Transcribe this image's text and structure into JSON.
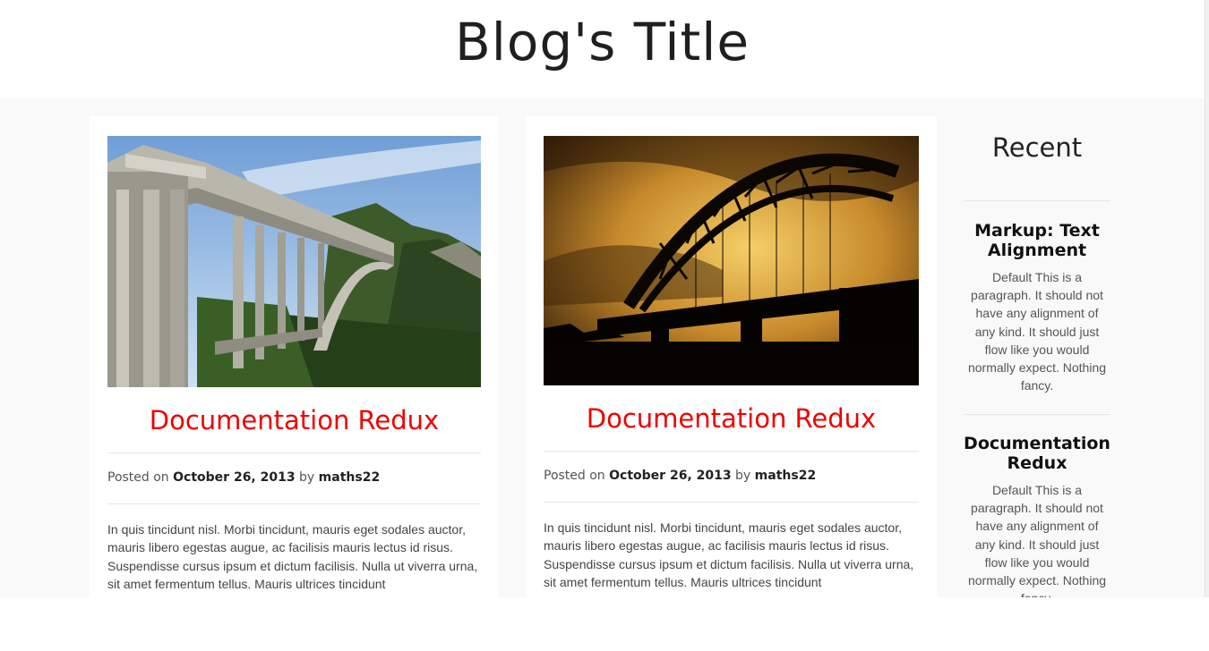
{
  "site": {
    "title": "Blog's Title"
  },
  "posts": [
    {
      "title": "Documentation Redux",
      "meta": {
        "prefix": "Posted on",
        "date": "October 26, 2013",
        "by": "by",
        "author": "maths22"
      },
      "excerpt": "In quis tincidunt nisl. Morbi tincidunt, mauris eget sodales auctor, mauris libero egestas augue, ac facilisis mauris lectus id risus. Suspendisse cursus ipsum et dictum facilisis. Nulla ut viverra urna, sit amet fermentum tellus. Mauris ultrices tincidunt"
    },
    {
      "title": "Documentation Redux",
      "meta": {
        "prefix": "Posted on",
        "date": "October 26, 2013",
        "by": "by",
        "author": "maths22"
      },
      "excerpt": "In quis tincidunt nisl. Morbi tincidunt, mauris eget sodales auctor, mauris libero egestas augue, ac facilisis mauris lectus id risus. Suspendisse cursus ipsum et dictum facilisis. Nulla ut viverra urna, sit amet fermentum tellus. Mauris ultrices tincidunt"
    }
  ],
  "sidebar": {
    "widget_title": "Recent",
    "items": [
      {
        "title": "Markup: Text Alignment",
        "excerpt": "Default This is a paragraph. It should not have any alignment of any kind. It should just flow like you would normally expect. Nothing fancy."
      },
      {
        "title": "Documentation Redux",
        "excerpt": "Default This is a paragraph. It should not have any alignment of any kind. It should just flow like you would normally expect. Nothing fancy."
      }
    ]
  },
  "colors": {
    "post_title": "#ee0000",
    "content_background": "#f9f9f9",
    "card_background": "#ffffff"
  },
  "images": [
    {
      "icon": "concrete-arch-bridge-photo"
    },
    {
      "icon": "steel-arch-bridge-sunset-photo"
    }
  ]
}
